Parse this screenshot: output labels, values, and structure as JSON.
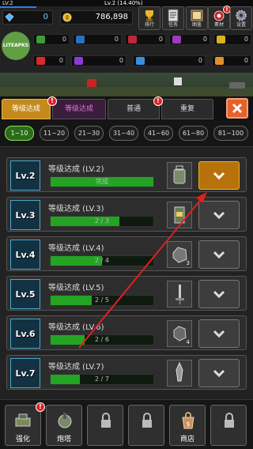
{
  "topbar": {
    "level": "LV.2",
    "level_progress": "Lv.2 (14.40%)",
    "xp_fraction": 0.144
  },
  "currency": {
    "gems": "0",
    "coins": "786,898"
  },
  "menu": [
    {
      "label": "排行",
      "icon": "trophy-icon"
    },
    {
      "label": "任务",
      "icon": "quest-icon"
    },
    {
      "label": "图鉴",
      "icon": "book-icon"
    },
    {
      "label": "素材",
      "icon": "materials-icon"
    },
    {
      "label": "设置",
      "icon": "gear-icon"
    }
  ],
  "resources_row1": [
    {
      "value": "0",
      "color": "#3c9d3c"
    },
    {
      "value": "0",
      "color": "#2b6fbf"
    },
    {
      "value": "0",
      "color": "#c2253c"
    },
    {
      "value": "0",
      "color": "#9c3bbd"
    },
    {
      "value": "0",
      "color": "#d9b21d"
    }
  ],
  "resources_row2": [
    {
      "value": "0",
      "color": "#d62b2b"
    },
    {
      "value": "0",
      "color": "#8b3ad6"
    },
    {
      "value": "0",
      "color": "#3a8ee0"
    },
    {
      "value": "0",
      "color": "#e0902b"
    }
  ],
  "watermark": "LITEAPKS",
  "tabs": [
    "等级达成",
    "等级达成",
    "普通",
    "重复"
  ],
  "filters": [
    "1~10",
    "11~20",
    "21~30",
    "31~40",
    "41~60",
    "61~80",
    "81~100"
  ],
  "items": [
    {
      "lv": "Lv.2",
      "title": "等级达成 (LV.2)",
      "progress": "完成",
      "pct": 1.0,
      "qty": "",
      "ready": true
    },
    {
      "lv": "Lv.3",
      "title": "等级达成 (LV.3)",
      "progress": "2 / 3",
      "pct": 0.667,
      "qty": "",
      "ready": false
    },
    {
      "lv": "Lv.4",
      "title": "等级达成 (LV.4)",
      "progress": "2 / 4",
      "pct": 0.5,
      "qty": "3",
      "ready": false
    },
    {
      "lv": "Lv.5",
      "title": "等级达成 (LV.5)",
      "progress": "2 / 5",
      "pct": 0.4,
      "qty": "",
      "ready": false
    },
    {
      "lv": "Lv.6",
      "title": "等级达成 (LV.6)",
      "progress": "2 / 6",
      "pct": 0.333,
      "qty": "4",
      "ready": false
    },
    {
      "lv": "Lv.7",
      "title": "等级达成 (LV.7)",
      "progress": "2 / 7",
      "pct": 0.286,
      "qty": "",
      "ready": false
    }
  ],
  "bottom_nav": [
    {
      "label": "强化",
      "icon": "upgrade-icon",
      "locked": false
    },
    {
      "label": "炮塔",
      "icon": "turret-icon",
      "locked": false
    },
    {
      "label": "",
      "icon": "lock-icon",
      "locked": true
    },
    {
      "label": "",
      "icon": "lock-icon",
      "locked": true
    },
    {
      "label": "商店",
      "icon": "shop-bag-icon",
      "locked": false
    },
    {
      "label": "",
      "icon": "lock-icon",
      "locked": true
    }
  ],
  "colors": {
    "accent_orange": "#c48a1d",
    "progress_green": "#23a523",
    "close_red": "#e6612b"
  }
}
